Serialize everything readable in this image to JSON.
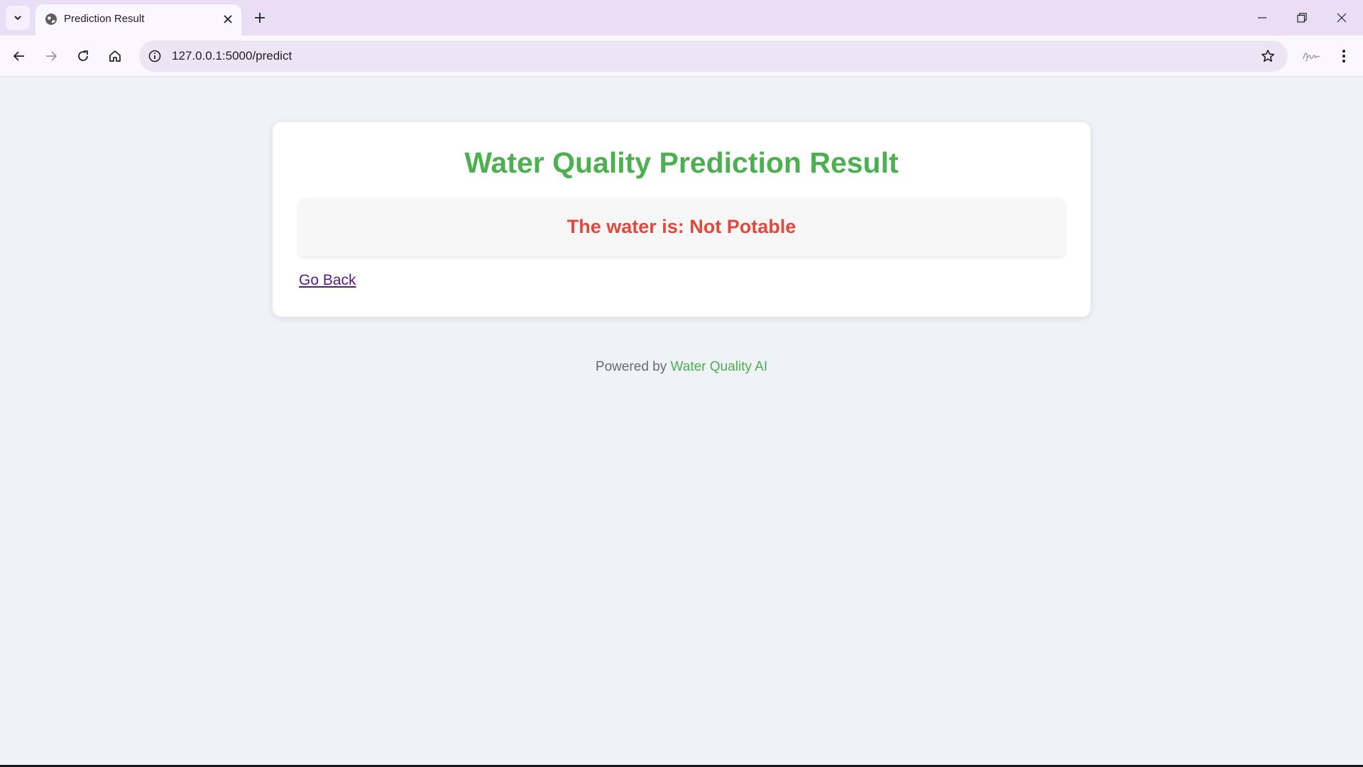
{
  "browser": {
    "tab_title": "Prediction Result",
    "url": "127.0.0.1:5000/predict"
  },
  "page": {
    "heading": "Water Quality Prediction Result",
    "result_text": "The water is: Not Potable",
    "back_link": "Go Back",
    "footer_prefix": "Powered by",
    "footer_brand": "Water Quality AI"
  },
  "colors": {
    "heading": "#4caf50",
    "result": "#e0493b",
    "brand": "#4caf50"
  },
  "icons": [
    "chevron-down-icon",
    "globe-icon",
    "close-icon",
    "plus-icon",
    "minimize-icon",
    "restore-icon",
    "back-icon",
    "forward-icon",
    "reload-icon",
    "home-icon",
    "info-icon",
    "star-icon",
    "kebab-menu-icon"
  ]
}
